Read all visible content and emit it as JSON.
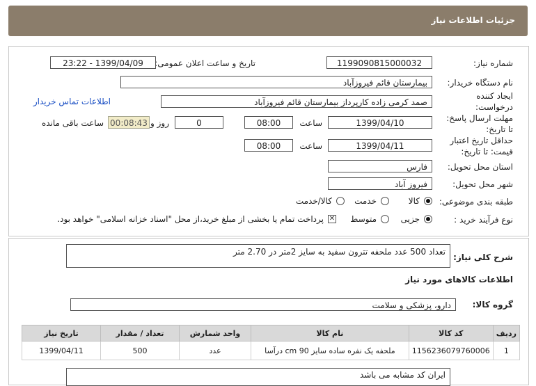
{
  "header": {
    "title": "جزئیات اطلاعات نیاز"
  },
  "form": {
    "need_number_label": "شماره نیاز:",
    "need_number": "1199090815000032",
    "announce_label": "تاریخ و ساعت اعلان عمومی:",
    "announce_value": "1399/04/09 - 23:22",
    "buyer_org_label": "نام دستگاه خریدار:",
    "buyer_org": "بیمارستان قائم فیروزآباد",
    "creator_label_1": "ایجاد کننده",
    "creator_label_2": "درخواست:",
    "creator": "صمد کرمی زاده کارپرداز بیمارستان قائم فیروزآباد",
    "contact_link": "اطلاعات تماس خریدار",
    "deadline_label_1": "مهلت ارسال پاسخ:",
    "deadline_label_2": "تا تاریخ:",
    "deadline_date": "1399/04/10",
    "time_label": "ساعت",
    "deadline_time": "08:00",
    "days_value": "0",
    "days_label": "روز و",
    "remaining_time": "00:08:43",
    "remaining_label": "ساعت باقی مانده",
    "validity_label_1": "حداقل تاریخ اعتبار",
    "validity_label_2": "قیمت: تا تاریخ:",
    "validity_date": "1399/04/11",
    "validity_time": "08:00",
    "province_label": "استان محل تحویل:",
    "province": "فارس",
    "city_label": "شهر محل تحویل:",
    "city": "فیروز آباد",
    "category_label": "طبقه بندی موضوعی:",
    "category_options": [
      "کالا",
      "خدمت",
      "کالا/خدمت"
    ],
    "category_selected": "کالا",
    "process_label": "نوع فرآیند خرید :",
    "process_options": [
      "جزیی",
      "متوسط"
    ],
    "process_selected": "جزیی",
    "payment_note": "پرداخت تمام یا بخشی از مبلغ خرید،از محل \"اسناد خزانه اسلامی\" خواهد بود."
  },
  "summary": {
    "label": "شرح کلی نیاز:",
    "text": "تعداد 500 عدد ملحفه تترون سفید به سایز 2متر در 2.70 متر"
  },
  "goods": {
    "section_title": "اطلاعات کالاهای مورد نیاز",
    "group_label": "گروه کالا:",
    "group_value": "دارو، پزشکی و سلامت",
    "columns": [
      "ردیف",
      "کد کالا",
      "نام کالا",
      "واحد شمارش",
      "تعداد / مقدار",
      "تاریخ نیاز"
    ],
    "rows": [
      [
        "1",
        "1156236079760006",
        "ملحفه یک نفره ساده سایز 90 cm درآسا",
        "عدد",
        "500",
        "1399/04/11"
      ]
    ],
    "note": "ایران کد مشابه می باشد"
  }
}
